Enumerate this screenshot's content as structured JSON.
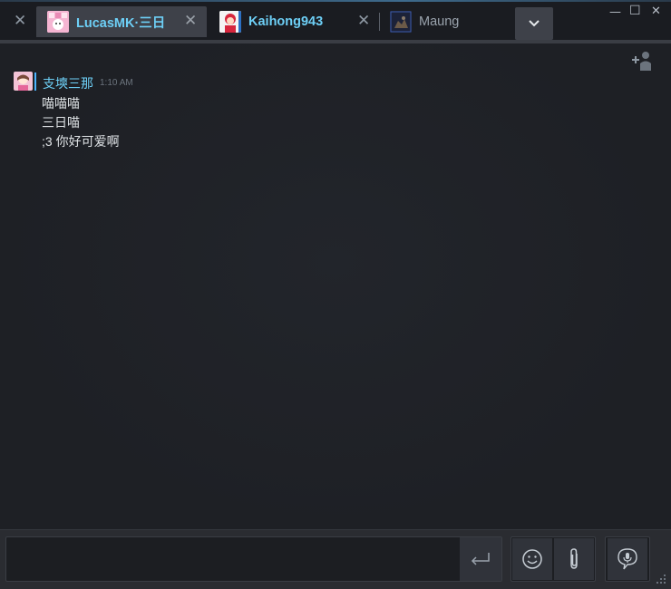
{
  "tabs": [
    {
      "name": "LucasMK·三日",
      "status": "online",
      "active": true,
      "avatar": "pink-avatar-icon"
    },
    {
      "name": "Kaihong943",
      "status": "online",
      "active": false,
      "avatar": "red-character-avatar-icon"
    },
    {
      "name": "Maung",
      "status": "offline",
      "active": false,
      "avatar": "dark-blue-avatar-icon"
    }
  ],
  "close_glyph": "✕",
  "window": {
    "minimize": "—",
    "maximize": "☐",
    "close": "✕"
  },
  "message": {
    "sender": "支塽三那",
    "time": "1:10 AM",
    "lines": [
      "喵喵喵",
      "三日喵",
      ";3 你好可爱啊"
    ]
  },
  "input": {
    "value": "",
    "placeholder": ""
  },
  "colors": {
    "accent": "#6dcff6",
    "background": "#1e2025",
    "tab_active": "#3e4149"
  },
  "icons": {
    "send": "enter-arrow-icon",
    "emoji": "smiley-icon",
    "attach": "paperclip-icon",
    "voice": "microphone-icon",
    "add_friend": "add-friend-icon"
  }
}
